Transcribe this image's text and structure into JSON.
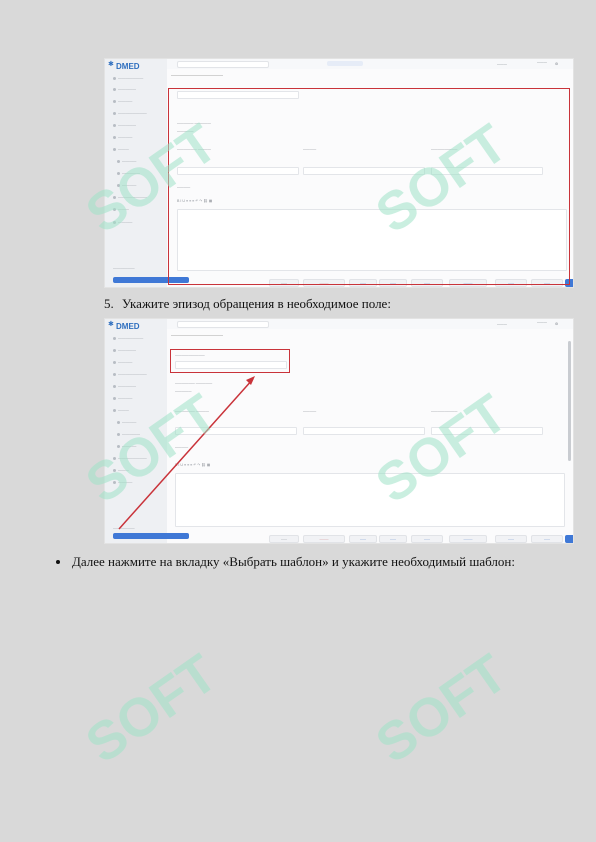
{
  "step5": {
    "number": "5.",
    "text": "Укажите эпизод обращения в необходимое поле:"
  },
  "bullet_item": {
    "text": "Далее нажмите на вкладку «Выбрать шаблон» и укажите необходимый шаблон:"
  },
  "screenshot": {
    "logo": "DMED",
    "accent_color": "#3f78d6",
    "highlight_color": "#c9333a"
  },
  "watermark": {
    "text": "SOFT",
    "color": "#9fe3c8"
  }
}
